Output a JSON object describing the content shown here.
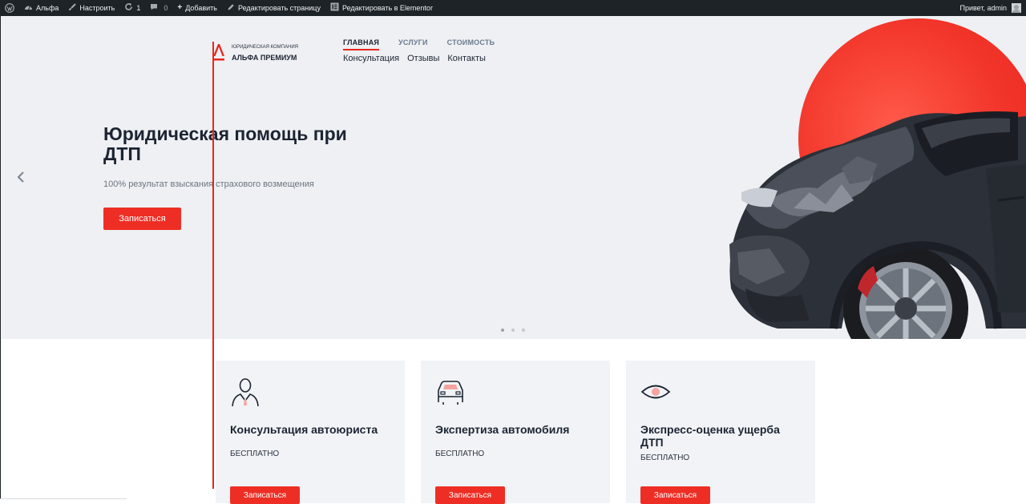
{
  "admin_bar": {
    "site_name": "Альфа",
    "customize": "Настроить",
    "updates_count": "1",
    "comments_count": "0",
    "add_new": "Добавить",
    "edit_page": "Редактировать страницу",
    "edit_elementor": "Редактировать в Elementor",
    "greeting": "Привет, admin",
    "icons": [
      "wordpress-icon",
      "dashboard-icon",
      "brush-icon",
      "refresh-icon",
      "comment-icon",
      "plus-icon",
      "pencil-icon",
      "elementor-icon",
      "avatar"
    ]
  },
  "logo": {
    "subtitle": "ЮРИДИЧЕСКАЯ КОМПАНИЯ",
    "name": "АЛЬФА ПРЕМИУМ"
  },
  "nav": {
    "primary": [
      "ГЛАВНАЯ",
      "УСЛУГИ",
      "СТОИМОСТЬ"
    ],
    "secondary": [
      "Консультация",
      "Отзывы",
      "Контакты"
    ]
  },
  "hero": {
    "title": "Юридическая помощь при ДТП",
    "subtitle": "100% результат взыскания страхового возмещения",
    "button": "Записаться",
    "slides_total": 3,
    "active_slide": 1
  },
  "cards": [
    {
      "title": "Консультация автоюриста",
      "price": "БЕСПЛАТНО",
      "button": "Записаться",
      "icon": "lawyer-person-icon"
    },
    {
      "title": "Экспертиза автомобиля",
      "price": "БЕСПЛАТНО",
      "button": "Записаться",
      "icon": "car-icon"
    },
    {
      "title": "Экспресс-оценка ущерба ДТП",
      "price": "БЕСПЛАТНО",
      "button": "Записаться",
      "icon": "eye-icon"
    }
  ],
  "colors": {
    "accent": "#ee2e24",
    "admin_bar": "#1d2327",
    "hero_bg": "#eef0f3",
    "text_dark": "#1c2432"
  }
}
